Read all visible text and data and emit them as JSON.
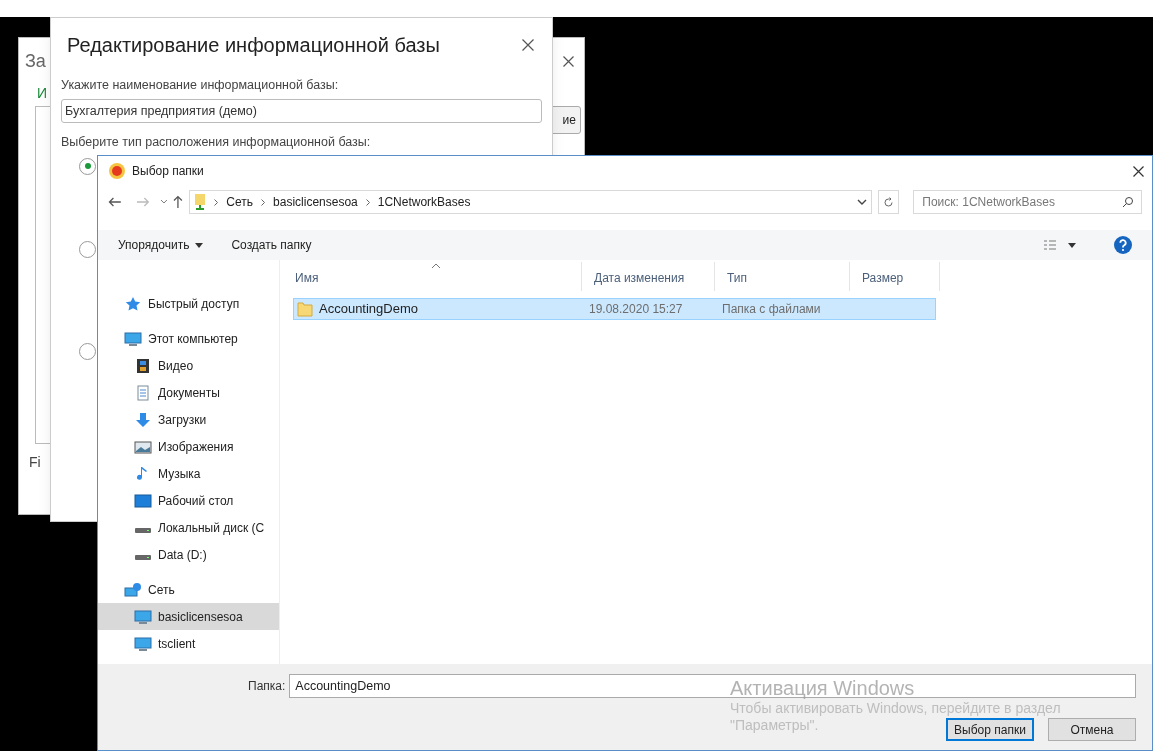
{
  "back_window": {
    "title": "За",
    "link": "И",
    "label": "Fi",
    "button": "ие"
  },
  "edit_dialog": {
    "title": "Редактирование информационной базы",
    "name_label": "Укажите наименование информационной базы:",
    "name_value": "Бухгалтерия предприятия (демо)",
    "location_label": "Выберите тип расположения информационной базы:",
    "location_options": [
      {
        "selected": true
      },
      {
        "selected": false
      },
      {
        "selected": false
      }
    ]
  },
  "folder_dialog": {
    "title": "Выбор папки",
    "path": [
      "Сеть",
      "basiclicensesoa",
      "1CNetworkBases"
    ],
    "search": {
      "placeholder": "Поиск: 1CNetworkBases"
    },
    "toolbar": [
      {
        "label": "Упорядочить",
        "dropdown": true
      },
      {
        "label": "Создать папку",
        "dropdown": false
      }
    ],
    "nav": [
      {
        "label": "Быстрый доступ",
        "kind": "star",
        "selected": false
      },
      {
        "label": "Этот компьютер",
        "kind": "computer",
        "selected": false,
        "children": [
          {
            "label": "Видео",
            "kind": "video",
            "selected": false
          },
          {
            "label": "Документы",
            "kind": "document",
            "selected": false
          },
          {
            "label": "Загрузки",
            "kind": "download",
            "selected": false
          },
          {
            "label": "Изображения",
            "kind": "image",
            "selected": false
          },
          {
            "label": "Музыка",
            "kind": "music",
            "selected": false
          },
          {
            "label": "Рабочий стол",
            "kind": "desktop",
            "selected": false
          },
          {
            "label": "Локальный диск (C",
            "kind": "drive",
            "selected": false
          },
          {
            "label": "Data (D:)",
            "kind": "drive",
            "selected": false
          }
        ]
      },
      {
        "label": "Сеть",
        "kind": "network",
        "selected": false,
        "children": [
          {
            "label": "basiclicensesoa",
            "kind": "computer",
            "selected": true
          },
          {
            "label": "tsclient",
            "kind": "computer",
            "selected": false
          }
        ]
      }
    ],
    "columns": [
      "Имя",
      "Дата изменения",
      "Тип",
      "Размер"
    ],
    "rows": [
      {
        "name": "AccountingDemo",
        "date": "19.08.2020 15:27",
        "type": "Папка с файлами",
        "selected": true
      }
    ],
    "folder_label": "Папка:",
    "folder_value": "AccountingDemo",
    "buttons": [
      {
        "label": "Выбор папки",
        "primary": true
      },
      {
        "label": "Отмена",
        "primary": false
      }
    ]
  },
  "watermark": {
    "title": "Активация Windows",
    "text_lines": [
      "Чтобы активировать Windows, перейдите в раздел",
      "\"Параметры\"."
    ]
  }
}
